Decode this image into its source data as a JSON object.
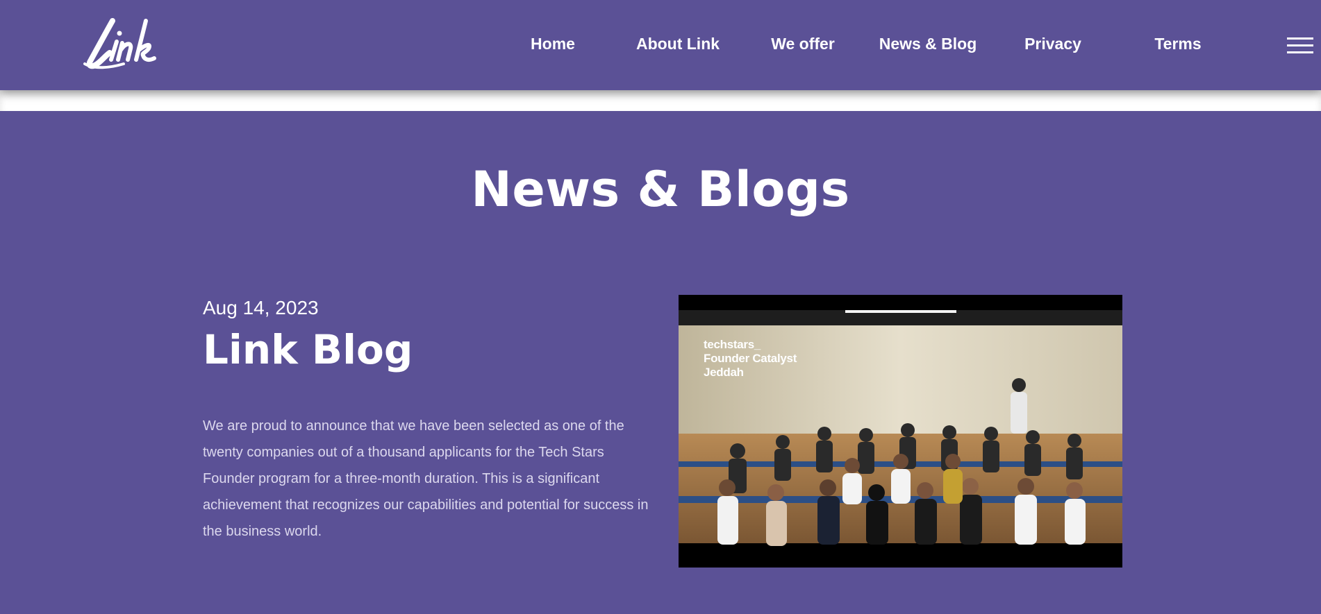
{
  "header": {
    "logo_text": "Link",
    "nav": [
      {
        "label": "Home"
      },
      {
        "label": "About Link"
      },
      {
        "label": "We offer"
      },
      {
        "label": "News & Blog"
      },
      {
        "label": "Privacy"
      },
      {
        "label": "Terms"
      }
    ],
    "menu_icon": "hamburger-icon"
  },
  "main": {
    "page_title": "News & Blogs",
    "post": {
      "date": "Aug 14, 2023",
      "title": "Link Blog",
      "excerpt": "We are proud to announce that we have been selected as one of the twenty companies out of a thousand applicants for the Tech Stars Founder program for a three-month duration. This is a significant achievement that recognizes our capabilities and potential for success in the business world.",
      "image": {
        "caption_lines": [
          "techstars_",
          "Founder Catalyst",
          "Jeddah"
        ]
      }
    }
  },
  "colors": {
    "brand_purple": "#5b5196",
    "text_white": "#ffffff",
    "excerpt_text": "#dcd8ee"
  }
}
